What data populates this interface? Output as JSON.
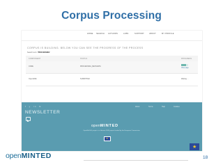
{
  "slide": {
    "title": "Corpus Processing",
    "page_number": "18",
    "logo_text_prefix": "open",
    "logo_text_brand": "MINTED"
  },
  "app": {
    "nav": [
      "HOME",
      "SEARCH",
      "AUTHORS",
      "LABS",
      "SUPPORT",
      "ABOUT",
      "MY PROFILE"
    ],
    "heading": "CORPUS IS BUILDING. BELOW YOU CAN SEE THE PROGRESS OF THE PROCESS",
    "corpus_label": "Search term:",
    "corpus_value": "'PROCESSING'",
    "table": {
      "headers": [
        "COMPONENT",
        "STATUS",
        "PROGRESS"
      ],
      "rows": [
        {
          "component": "CORE",
          "status": "PROCESSING_METADATA",
          "progress": 0.7,
          "link": "View page"
        },
        {
          "component": "OpenAIRE",
          "status": "SUBMITTED",
          "progress_text": "Waiting ..."
        }
      ]
    },
    "footer": {
      "social": [
        "f",
        "y",
        "in",
        "G"
      ],
      "links": [
        "About",
        "Terms",
        "Help",
        "Cookies"
      ],
      "newsletter_title": "NEWSLETTER",
      "logo_prefix": "open",
      "logo_brand": "MINTED",
      "funding_text": "OpenMinTeD project is a Horizon 2020 project funded by the European Commission"
    }
  },
  "colors": {
    "title": "#2e6ea6",
    "footer_bg": "#5a9cb0",
    "progress": "#6db7ad",
    "eu_blue": "#2a4a9a",
    "eu_star": "#f2cc2c"
  }
}
